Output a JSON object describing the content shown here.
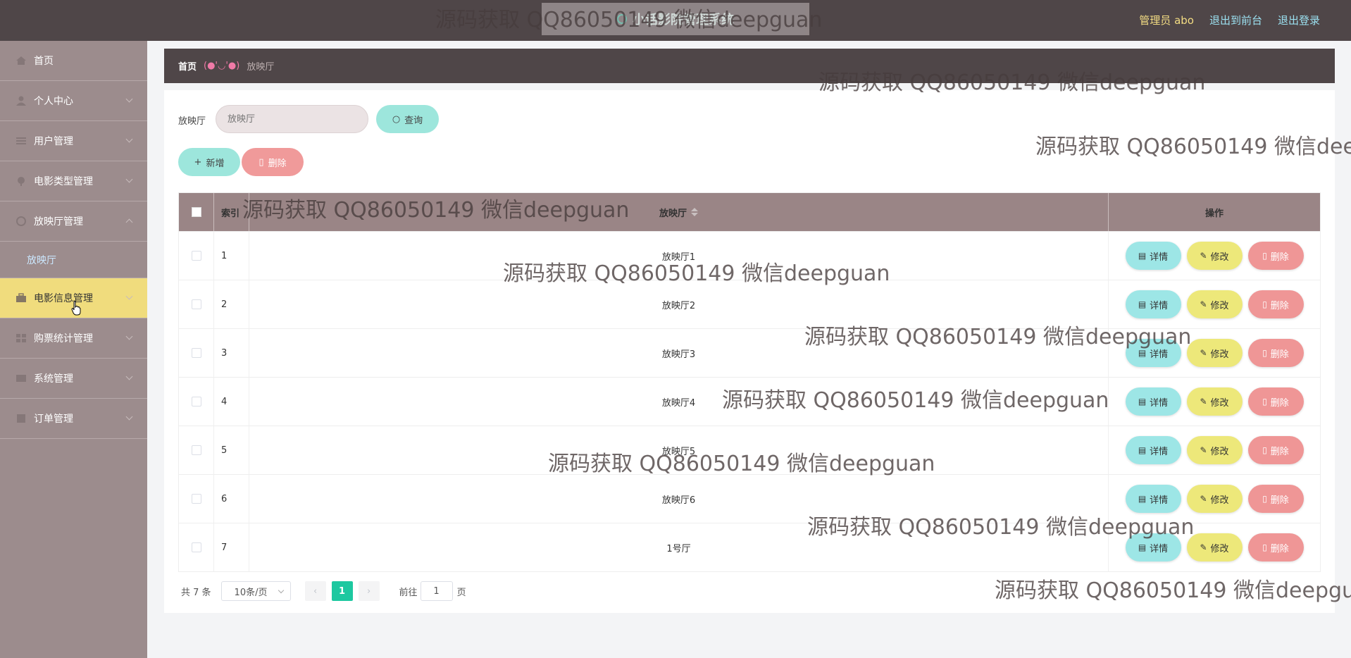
{
  "header": {
    "title": "小话影院管理系统",
    "admin_label": "管理员 abo",
    "front_link": "退出到前台",
    "logout_link": "退出登录"
  },
  "sidebar": {
    "items": [
      {
        "label": "首页",
        "icon": "home-icon"
      },
      {
        "label": "个人中心",
        "icon": "user-icon"
      },
      {
        "label": "用户管理",
        "icon": "list-icon"
      },
      {
        "label": "电影类型管理",
        "icon": "tag-icon"
      },
      {
        "label": "放映厅管理",
        "icon": "circle-icon"
      },
      {
        "label": "电影信息管理",
        "icon": "briefcase-icon"
      },
      {
        "label": "购票统计管理",
        "icon": "grid-icon"
      },
      {
        "label": "系统管理",
        "icon": "settings-icon"
      },
      {
        "label": "订单管理",
        "icon": "document-icon"
      }
    ],
    "sub_item": "放映厅"
  },
  "breadcrumb": {
    "home": "首页",
    "face": "(●'◡'●)",
    "current": "放映厅"
  },
  "search": {
    "label": "放映厅",
    "placeholder": "放映厅",
    "button": "查询"
  },
  "actions": {
    "add": "新增",
    "delete": "删除"
  },
  "table": {
    "headers": {
      "index": "索引",
      "name": "放映厅",
      "ops": "操作"
    },
    "rows": [
      {
        "index": "1",
        "name": "放映厅1"
      },
      {
        "index": "2",
        "name": "放映厅2"
      },
      {
        "index": "3",
        "name": "放映厅3"
      },
      {
        "index": "4",
        "name": "放映厅4"
      },
      {
        "index": "5",
        "name": "放映厅5"
      },
      {
        "index": "6",
        "name": "放映厅6"
      },
      {
        "index": "7",
        "name": "1号厅"
      }
    ],
    "op_labels": {
      "detail": "详情",
      "edit": "修改",
      "delete": "删除"
    }
  },
  "pagination": {
    "total": "共 7 条",
    "page_size": "10条/页",
    "current_page": "1",
    "goto_label": "前往",
    "goto_value": "1",
    "page_suffix": "页"
  },
  "watermark": "源码获取 QQ86050149 微信deepguan",
  "colors": {
    "topbar": "#4f4648",
    "sidebar": "#9c8c8d",
    "active_menu": "#f0dc7d",
    "table_header": "#9a8586",
    "teal_button": "#9de6dc",
    "yellow_button": "#ede87a",
    "red_button": "#ef9696",
    "page_active": "#1dc8a0"
  }
}
